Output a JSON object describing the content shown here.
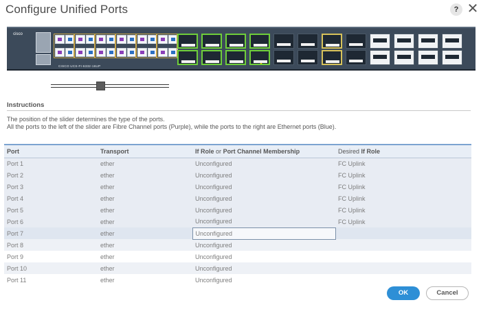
{
  "dialog": {
    "title": "Configure Unified Ports",
    "help_icon": "?",
    "close_icon": "✕"
  },
  "switch": {
    "brand": "cisco",
    "model": "CISCO UCS-FI-6332-16UP",
    "port_colors": {
      "fibre_channel": "#8a3fb8",
      "ethernet": "#2b6fc2",
      "selected_group": "#6fcf3a",
      "highlight_group": "#d8c35a"
    }
  },
  "instructions": {
    "heading": "Instructions",
    "line1": "The position of the slider determines the type of the ports.",
    "line2": "All the ports to the left of the slider are Fibre Channel ports (Purple), while the ports to the right are Ethernet ports (Blue)."
  },
  "table": {
    "headers": {
      "port": "Port",
      "transport": "Transport",
      "role_part1": "If Role",
      "role_or": "or",
      "role_part2": "Port Channel Membership",
      "desired_prefix": "Desired",
      "desired_bold": "If Role"
    },
    "rows": [
      {
        "port": "Port 1",
        "transport": "ether",
        "role": "Unconfigured",
        "desired": "FC Uplink"
      },
      {
        "port": "Port 2",
        "transport": "ether",
        "role": "Unconfigured",
        "desired": "FC Uplink"
      },
      {
        "port": "Port 3",
        "transport": "ether",
        "role": "Unconfigured",
        "desired": "FC Uplink"
      },
      {
        "port": "Port 4",
        "transport": "ether",
        "role": "Unconfigured",
        "desired": "FC Uplink"
      },
      {
        "port": "Port 5",
        "transport": "ether",
        "role": "Unconfigured",
        "desired": "FC Uplink"
      },
      {
        "port": "Port 6",
        "transport": "ether",
        "role": "Unconfigured",
        "desired": "FC Uplink"
      },
      {
        "port": "Port 7",
        "transport": "ether",
        "role": "Unconfigured",
        "desired": ""
      },
      {
        "port": "Port 8",
        "transport": "ether",
        "role": "Unconfigured",
        "desired": ""
      },
      {
        "port": "Port 9",
        "transport": "ether",
        "role": "Unconfigured",
        "desired": ""
      },
      {
        "port": "Port 10",
        "transport": "ether",
        "role": "Unconfigured",
        "desired": ""
      },
      {
        "port": "Port 11",
        "transport": "ether",
        "role": "Unconfigured",
        "desired": ""
      }
    ]
  },
  "buttons": {
    "ok": "OK",
    "cancel": "Cancel"
  }
}
